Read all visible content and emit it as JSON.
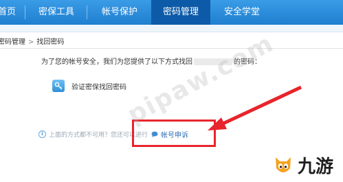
{
  "nav": {
    "items": [
      "首页",
      "密保工具",
      "帐号保护",
      "密码管理",
      "安全学堂"
    ],
    "active": "密码管理"
  },
  "breadcrumb": {
    "parent": "密码管理",
    "current": "找回密码"
  },
  "intro": {
    "before": "为了您的帐号安全，我们为您提供了以下方式找回",
    "after": "的密码："
  },
  "method": {
    "label": "验证密保找回密码",
    "icon": "key-icon"
  },
  "fallback": {
    "text": "上面的方式都不可用？您还可以进行",
    "link": "帐号申诉"
  },
  "watermark": "pipaw.com",
  "brand": {
    "text": "九游",
    "icon": "fox-mascot-icon"
  },
  "colors": {
    "nav": "#1f7fd0",
    "nav_active": "#0d5ba8",
    "highlight": "#e8242c",
    "link": "#2f6fb5"
  }
}
